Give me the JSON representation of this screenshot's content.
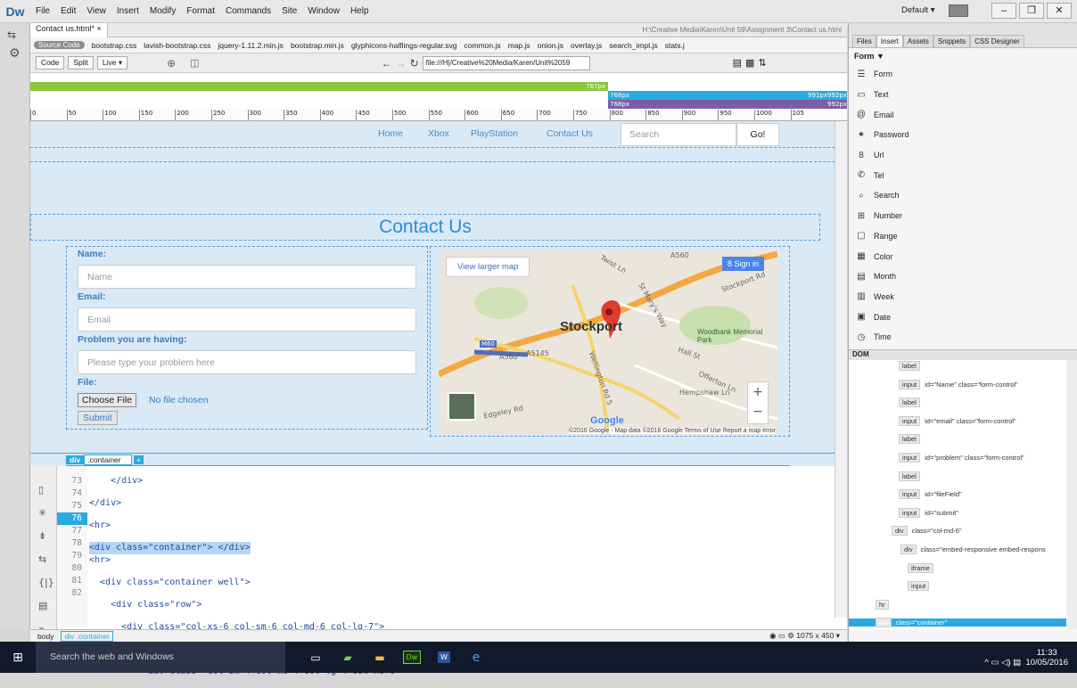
{
  "app": {
    "logo": "Dw",
    "layout": "Default",
    "menus": [
      "File",
      "Edit",
      "View",
      "Insert",
      "Modify",
      "Format",
      "Commands",
      "Site",
      "Window",
      "Help"
    ]
  },
  "document": {
    "tab": "Contact us.html*",
    "path": "H:\\Creative Media\\Karen\\Unit 59\\Assignment 3\\Contact us.html",
    "related_files": [
      "Source Code",
      "bootstrap.css",
      "lavish-bootstrap.css",
      "jquery-1.11.2.min.js",
      "bootstrap.min.js",
      "glyphicons-halflings-regular.svg",
      "common.js",
      "map.js",
      "onion.js",
      "overlay.js",
      "search_impl.js",
      "stats.j"
    ],
    "views": [
      "Code",
      "Split",
      "Live"
    ],
    "url": "file:///H|/Creative%20Media/Karen/Unit%2059"
  },
  "media_queries": {
    "q1": "767px",
    "q2a": "768px",
    "q2b": "991px",
    "q2c": "992px",
    "q3a": "768px",
    "q3b": "992px"
  },
  "ruler": [
    "0",
    "50",
    "100",
    "150",
    "200",
    "250",
    "300",
    "350",
    "400",
    "450",
    "500",
    "550",
    "600",
    "650",
    "700",
    "750",
    "800",
    "850",
    "900",
    "950",
    "1000",
    "105"
  ],
  "page": {
    "nav": [
      "Home",
      "Xbox",
      "PlayStation",
      "Contact Us"
    ],
    "search_placeholder": "Search",
    "go": "Go!",
    "heading": "Contact Us",
    "labels": {
      "name": "Name:",
      "email": "Email:",
      "problem": "Problem you are having:",
      "file": "File:"
    },
    "placeholders": {
      "name": "Name",
      "email": "Email",
      "problem": "Please type your problem here"
    },
    "choose_file": "Choose File",
    "no_file": "No file chosen",
    "submit": "Submit"
  },
  "map": {
    "larger": "View larger map",
    "signin": "Sign in",
    "city": "Stockport",
    "park": "Woodbank Memorial Park",
    "roads": [
      "A560",
      "A5145",
      "M60",
      "Wellington Rd S",
      "Hall St",
      "Offerton Ln",
      "Hempshaw Ln",
      "Edgeley Rd",
      "St Mary's Way",
      "Twist Ln",
      "Stockport Rd"
    ],
    "attribution": "©2016 Google - Map data ©2016 Google  Terms of Use  Report a map error",
    "google": "Google"
  },
  "tag_selector": {
    "tag": "div",
    "class": ".container",
    "plus": "+"
  },
  "code": {
    "lines": [
      {
        "n": "73",
        "t": "    </div>"
      },
      {
        "n": "74",
        "t": "</div>"
      },
      {
        "n": "75",
        "t": "<hr>"
      },
      {
        "n": "76",
        "t": "<div class=\"container\"> </div>"
      },
      {
        "n": "77",
        "t": "<hr>"
      },
      {
        "n": "78",
        "t": "  <div class=\"container well\">"
      },
      {
        "n": "79",
        "t": "    <div class=\"row\">"
      },
      {
        "n": "80",
        "t": "      <div class=\"col-xs-6 col-sm-6 col-md-6 col-lg-7\">"
      },
      {
        "n": "81",
        "t": "        <div class=\"row\">"
      },
      {
        "n": "82",
        "t": "          <div class=\"col-sm-4 col-md-4 col-lg-4 col-xs-6\">"
      }
    ]
  },
  "status": {
    "crumb1": "body",
    "crumb2": "div",
    "crumb2b": ".container",
    "size": "1075 x 450"
  },
  "panel": {
    "tabs": [
      "Files",
      "Insert",
      "Assets",
      "Snippets",
      "CSS Designer"
    ],
    "category": "Form",
    "items": [
      {
        "icon": "☰",
        "label": "Form"
      },
      {
        "icon": "▭",
        "label": "Text"
      },
      {
        "icon": "@",
        "label": "Email"
      },
      {
        "icon": "⁕",
        "label": "Password"
      },
      {
        "icon": "8",
        "label": "Url"
      },
      {
        "icon": "✆",
        "label": "Tel"
      },
      {
        "icon": "⌕",
        "label": "Search"
      },
      {
        "icon": "⊞",
        "label": "Number"
      },
      {
        "icon": "▢",
        "label": "Range"
      },
      {
        "icon": "▦",
        "label": "Color"
      },
      {
        "icon": "▤",
        "label": "Month"
      },
      {
        "icon": "▥",
        "label": "Week"
      },
      {
        "icon": "▣",
        "label": "Date"
      },
      {
        "icon": "◷",
        "label": "Time"
      }
    ],
    "dom_title": "DOM",
    "dom": [
      {
        "tag": "label",
        "attr": ""
      },
      {
        "tag": "input",
        "attr": "id=\"Name\" class=\"form-control\""
      },
      {
        "tag": "label",
        "attr": ""
      },
      {
        "tag": "input",
        "attr": "id=\"email\" class=\"form-control\""
      },
      {
        "tag": "label",
        "attr": ""
      },
      {
        "tag": "input",
        "attr": "id=\"problem\" class=\"form-control\""
      },
      {
        "tag": "label",
        "attr": ""
      },
      {
        "tag": "input",
        "attr": "id=\"fileField\""
      },
      {
        "tag": "input",
        "attr": "id=\"submit\""
      },
      {
        "tag": "div",
        "attr": "class=\"col-md-6\""
      },
      {
        "tag": "div",
        "attr": "class=\"embed-responsive embed-respons"
      },
      {
        "tag": "iframe",
        "attr": ""
      },
      {
        "tag": "input",
        "attr": ""
      },
      {
        "tag": "hr",
        "attr": ""
      },
      {
        "tag": "div",
        "attr": "class=\"container\""
      }
    ]
  },
  "taskbar": {
    "search": "Search the web and Windows",
    "time": "11:33",
    "date": "10/05/2016"
  }
}
